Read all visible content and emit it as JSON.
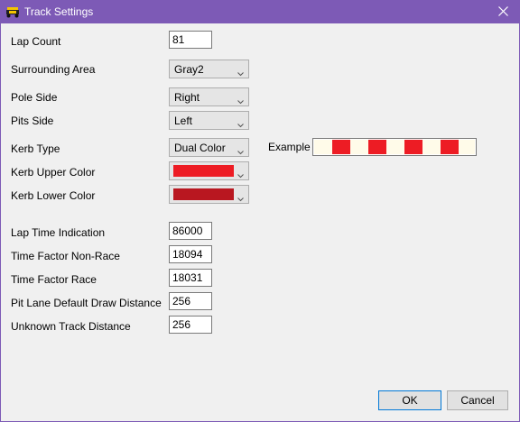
{
  "window": {
    "title": "Track Settings",
    "accent_color": "#7d5ab6"
  },
  "fields": {
    "lap_count": {
      "label": "Lap Count",
      "value": "81"
    },
    "surrounding_area": {
      "label": "Surrounding Area",
      "value": "Gray2"
    },
    "pole_side": {
      "label": "Pole Side",
      "value": "Right"
    },
    "pits_side": {
      "label": "Pits Side",
      "value": "Left"
    },
    "kerb_type": {
      "label": "Kerb Type",
      "value": "Dual Color"
    },
    "kerb_upper_color": {
      "label": "Kerb Upper Color",
      "color": "#ed1c24"
    },
    "kerb_lower_color": {
      "label": "Kerb Lower Color",
      "color": "#b91720"
    },
    "lap_time_indication": {
      "label": "Lap Time Indication",
      "value": "86000"
    },
    "time_factor_non_race": {
      "label": "Time Factor Non-Race",
      "value": "18094"
    },
    "time_factor_race": {
      "label": "Time Factor Race",
      "value": "18031"
    },
    "pit_lane_draw_distance": {
      "label": "Pit Lane Default Draw Distance",
      "value": "256"
    },
    "unknown_track_distance": {
      "label": "Unknown Track Distance",
      "value": "256"
    }
  },
  "example": {
    "label": "Example",
    "stripe_colors": [
      "#fffbe9",
      "#ed1c24"
    ]
  },
  "buttons": {
    "ok": "OK",
    "cancel": "Cancel"
  }
}
